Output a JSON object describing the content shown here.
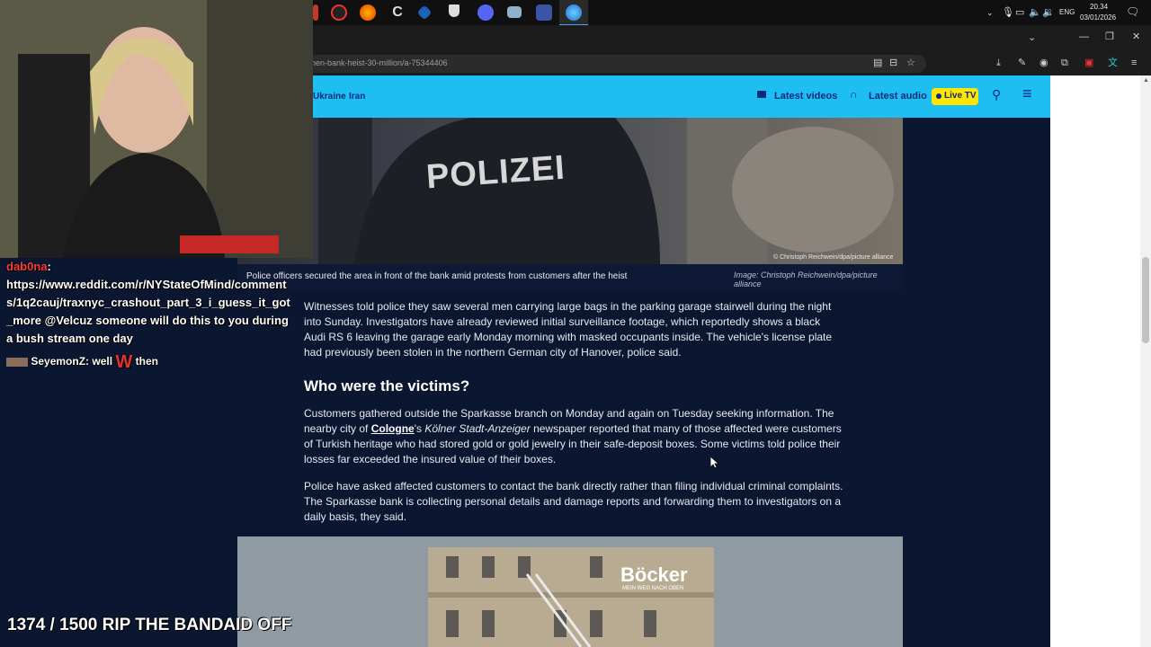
{
  "taskbar": {
    "time": "20.34",
    "date": "03/01/2026",
    "language": "ENG",
    "app_icons": [
      "red-app-icon",
      "firefox-icon",
      "ccleaner-icon",
      "blue-app-icon",
      "shield-icon",
      "discord-icon",
      "folder-icon",
      "game-icon",
      "browser-icon"
    ]
  },
  "browser": {
    "url": "hen-bank-heist-30-million/a-75344406"
  },
  "site_nav": {
    "links": [
      "Ukraine",
      "Iran"
    ],
    "latest_videos": "Latest videos",
    "latest_audio": "Latest audio",
    "live_tv": "Live TV"
  },
  "article": {
    "photo_overlay_text": "POLIZEI",
    "photo_watermark": "© Christoph Reichwein/dpa/picture alliance",
    "caption": "Police officers secured the area in front of the bank amid protests from customers after the heist",
    "caption_credit": "Image: Christoph Reichwein/dpa/picture alliance",
    "p1": "Witnesses told police they saw several men carrying large bags in the parking garage stairwell during the night into Sunday. Investigators have already reviewed initial surveillance footage, which reportedly shows a black Audi RS 6 leaving the garage early Monday morning with masked occupants inside. The vehicle's license plate had previously been stolen in the northern German city of Hanover, police said.",
    "heading": "Who were the victims?",
    "p2_a": "Customers gathered outside the Sparkasse branch on Monday and again on Tuesday seeking information. The nearby city of ",
    "p2_link": "Cologne",
    "p2_b": "'s ",
    "p2_italic": "Kölner Stadt-Anzeiger",
    "p2_c": " newspaper reported that many of those affected were customers of Turkish heritage who had stored gold or gold jewelry in their safe-deposit boxes. Some victims told police their losses far exceeded the insured value of their boxes.",
    "p3": "Police have asked affected customers to contact the bank directly rather than filing individual criminal complaints. The Sparkasse bank is collecting personal details and damage reports and forwarding them to investigators on a daily basis, they said.",
    "photo2_sign": "Böcker",
    "photo2_sign_sub": "MEIN WEG NACH OBEN"
  },
  "stream_overlay": {
    "chat": [
      {
        "user": "dab0na",
        "user_color": "#ff3b3b",
        "message": "https://www.reddit.com/r/NYStateOfMind/comments/1q2cauj/traxnyc_crashout_part_3_i_guess_it_got_more @Velcuz someone will do this to you during a bush stream one day"
      },
      {
        "user": "SeyemonZ",
        "user_color": "#ffffff",
        "message": "well",
        "emote": "W",
        "message_after": "then"
      }
    ],
    "counter": "1374 / 1500 RIP THE BANDAID OFF"
  }
}
